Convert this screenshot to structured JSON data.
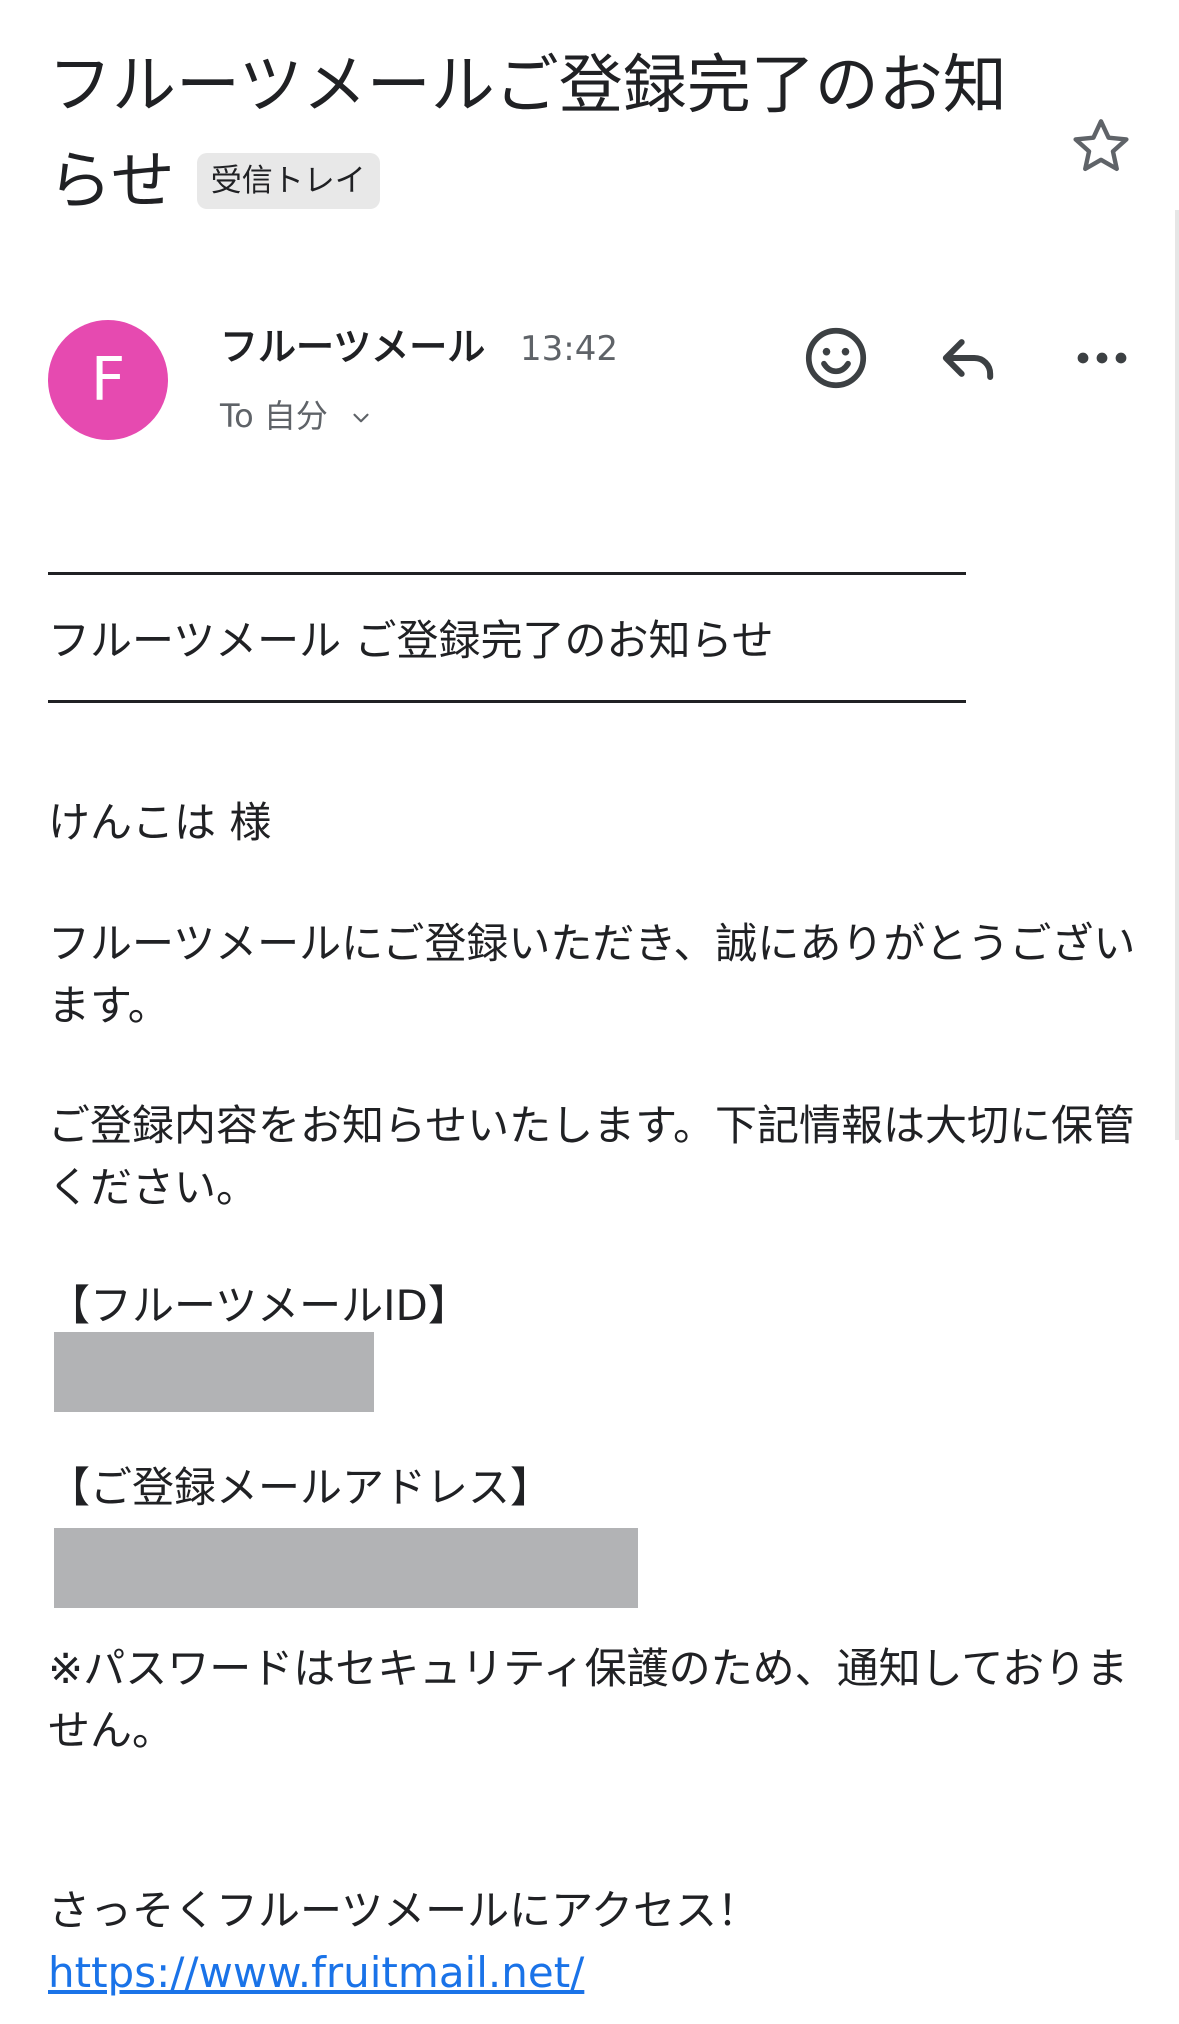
{
  "header": {
    "subject": "フルーツメールご登録完了のお知らせ",
    "label_chip": "受信トレイ",
    "star_icon": "star-outline-icon"
  },
  "sender": {
    "avatar_letter": "F",
    "avatar_color": "#e64ab0",
    "name": "フルーツメール",
    "time": "13:42",
    "recipients": "To 自分"
  },
  "actions": {
    "emoji_icon": "add-reaction-icon",
    "reply_icon": "reply-icon",
    "more_icon": "more-options-icon"
  },
  "body": {
    "title": "フルーツメール ご登録完了のお知らせ",
    "greeting": "けんこは 様",
    "thanks": "フルーツメールにご登録いただき、誠にありがとうございます。",
    "notice": "ご登録内容をお知らせいたします。下記情報は大切に保管ください。",
    "id_heading": "【フルーツメールID】",
    "email_heading": "【ご登録メールアドレス】",
    "password_note": "※パスワードはセキュリティ保護のため、通知しておりません。",
    "access_line": "さっそくフルーツメールにアクセス！",
    "url": "https://www.fruitmail.net/"
  },
  "colors": {
    "link": "#1a73e8",
    "secondary_text": "#5f6368",
    "redaction": "#b2b3b5"
  }
}
